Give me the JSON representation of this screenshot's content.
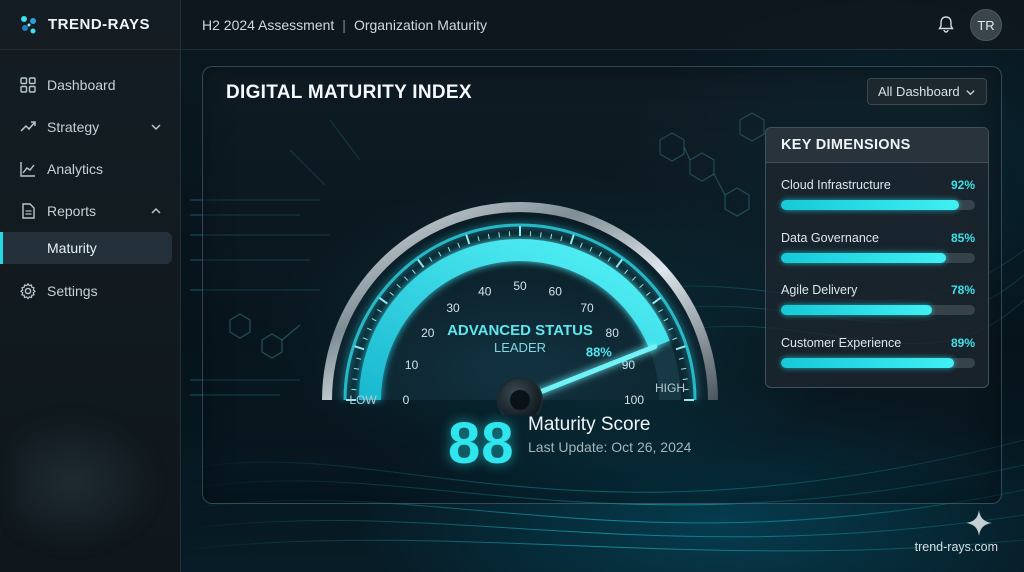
{
  "brand": {
    "name": "TREND-RAYS"
  },
  "topbar": {
    "breadcrumb": [
      "H2 2024 Assessment",
      "Organization Maturity"
    ],
    "separator": "|",
    "avatar_initials": "TR"
  },
  "sidebar": {
    "items": [
      {
        "label": "Dashboard",
        "icon": "grid-icon"
      },
      {
        "label": "Strategy",
        "icon": "trend-icon",
        "expandable": true,
        "expanded": false
      },
      {
        "label": "Analytics",
        "icon": "line-chart-icon"
      },
      {
        "label": "Reports",
        "icon": "document-icon",
        "expandable": true,
        "expanded": true,
        "children": [
          {
            "label": "Maturity",
            "active": true
          }
        ]
      },
      {
        "label": "Settings",
        "icon": "gear-icon"
      }
    ]
  },
  "card": {
    "title": "DIGITAL MATURITY INDEX",
    "dropdown": {
      "selected": "All Dashboard"
    }
  },
  "gauge": {
    "status_title": "ADVANCED STATUS",
    "status_sub": "LEADER",
    "value": 88,
    "value_label": "88%",
    "min": 0,
    "max": 100,
    "ticks": [
      "0",
      "10",
      "20",
      "30",
      "40",
      "50",
      "60",
      "70",
      "80",
      "90",
      "100"
    ],
    "low_label": "LOW",
    "high_label": "HIGH"
  },
  "score": {
    "value": "88",
    "label": "Maturity Score",
    "updated": "Last Update: Oct 26, 2024"
  },
  "key_dimensions": {
    "title": "KEY DIMENSIONS",
    "items": [
      {
        "label": "Cloud Infrastructure",
        "pct_label": "92%",
        "value": 0.92
      },
      {
        "label": "Data Governance",
        "pct_label": "85%",
        "value": 0.85
      },
      {
        "label": "Agile Delivery",
        "pct_label": "78%",
        "value": 0.78
      },
      {
        "label": "Customer Experience",
        "pct_label": "89%",
        "value": 0.89
      }
    ]
  },
  "footer": {
    "site": "trend-rays.com"
  },
  "colors": {
    "accent": "#2fe6ee",
    "sidebar_bg": "#141d23",
    "page_bg": "#071219"
  }
}
